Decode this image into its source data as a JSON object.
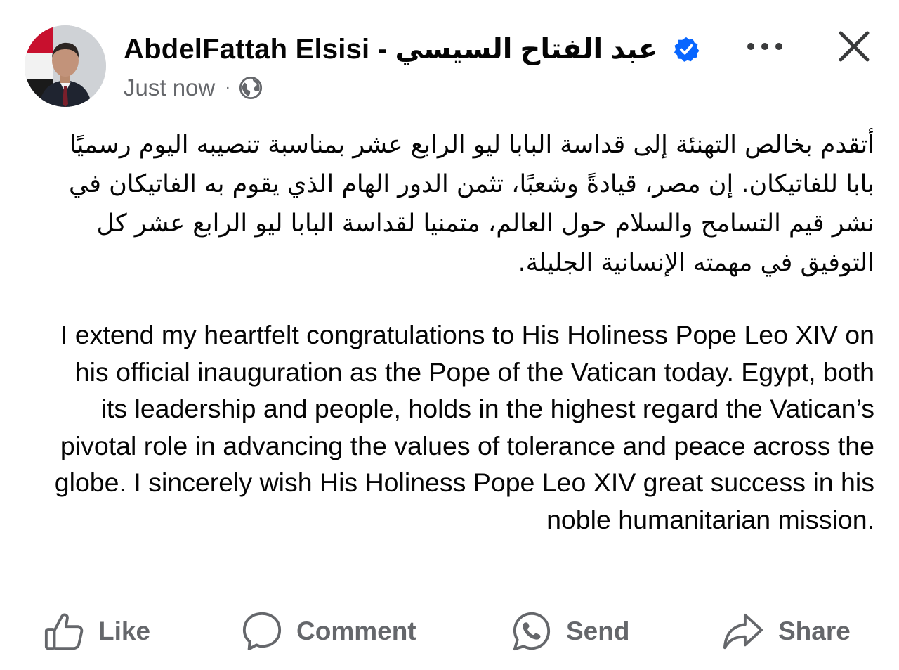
{
  "post": {
    "author": "AbdelFattah Elsisi - عبد الفتاح السيسي",
    "timestamp": "Just now",
    "separator": "·",
    "audience_icon": "globe-icon",
    "verified_icon": "verified-badge-icon",
    "text_arabic": "أتقدم بخالص التهنئة إلى قداسة البابا ليو الرابع عشر بمناسبة تنصيبه اليوم رسميًا بابا للفاتيكان. إن مصر، قيادةً وشعبًا، تثمن الدور الهام الذي يقوم به الفاتيكان في نشر قيم التسامح والسلام حول العالم، متمنيا لقداسة البابا ليو الرابع عشر كل التوفيق في مهمته الإنسانية الجليلة.",
    "text_english": "I extend my heartfelt congratulations to His Holiness Pope Leo XIV on his official inauguration as the Pope of the Vatican today. Egypt, both its leadership and people, holds in the highest regard the Vatican’s pivotal role in advancing the values of tolerance and peace across the globe. I sincerely wish His Holiness Pope Leo XIV great success in his noble humanitarian mission."
  },
  "header_actions": {
    "more_icon": "more-options-icon",
    "close_icon": "close-icon"
  },
  "actions": {
    "like": "Like",
    "comment": "Comment",
    "send": "Send",
    "share": "Share"
  },
  "colors": {
    "text_primary": "#050505",
    "text_secondary": "#65676b",
    "verified_blue": "#0866ff"
  }
}
